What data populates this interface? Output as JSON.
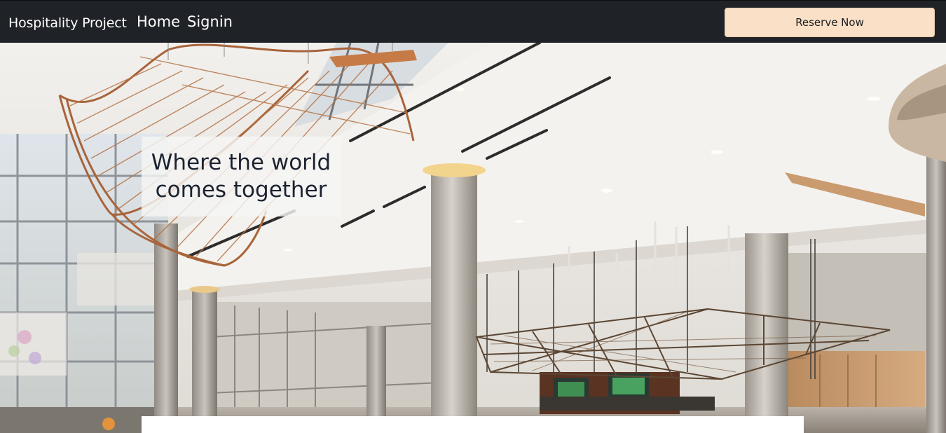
{
  "navbar": {
    "brand": "Hospitality Project",
    "links": [
      {
        "label": "Home"
      },
      {
        "label": "Signin"
      }
    ],
    "reserve_label": "Reserve Now"
  },
  "hero": {
    "tagline": "Where the world comes together",
    "image_description": "hotel-lobby-photo"
  },
  "colors": {
    "navbar_bg": "#1f2226",
    "reserve_button_bg": "#f9e0c7",
    "tagline_text": "#1b2230"
  }
}
